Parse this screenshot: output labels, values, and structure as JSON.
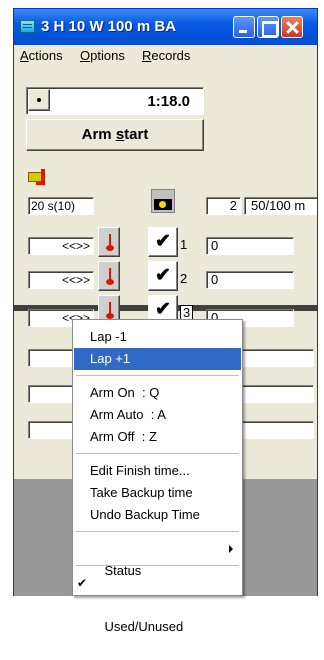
{
  "window": {
    "title": "3 H 10 W 100 m BA",
    "accent": "#0a5ae3"
  },
  "menubar": [
    "Actions",
    "Options",
    "Records"
  ],
  "timer": {
    "value": "1:18.0"
  },
  "arm_button": {
    "label_pre": "Arm ",
    "label_ul": "s",
    "label_post": "tart"
  },
  "header": {
    "split": "20 s(10)",
    "count": "2",
    "distance": "50/100 m"
  },
  "lanes": [
    {
      "arrows": "<<>>",
      "number": "1",
      "boxed": false,
      "value": "0"
    },
    {
      "arrows": "<<>>",
      "number": "2",
      "boxed": false,
      "value": "0"
    },
    {
      "arrows": "<<>>",
      "number": "3",
      "boxed": true,
      "value": "0"
    },
    {
      "arrows": "<<",
      "number": "",
      "boxed": false,
      "value": ""
    },
    {
      "arrows": "<<",
      "number": "",
      "boxed": false,
      "value": ""
    },
    {
      "arrows": "<<",
      "number": "",
      "boxed": false,
      "value": ""
    }
  ],
  "context_menu": {
    "items": [
      {
        "label": "Lap -1"
      },
      {
        "label": "Lap +1",
        "selected": true
      },
      {
        "label": "Arm On  : Q"
      },
      {
        "label": "Arm Auto  : A"
      },
      {
        "label": "Arm Off  : Z"
      },
      {
        "label": "Edit Finish time..."
      },
      {
        "label": "Take Backup time"
      },
      {
        "label": "Undo Backup Time"
      },
      {
        "label": "Status",
        "submenu": true
      },
      {
        "label": "Used/Unused",
        "checked": true
      }
    ]
  }
}
